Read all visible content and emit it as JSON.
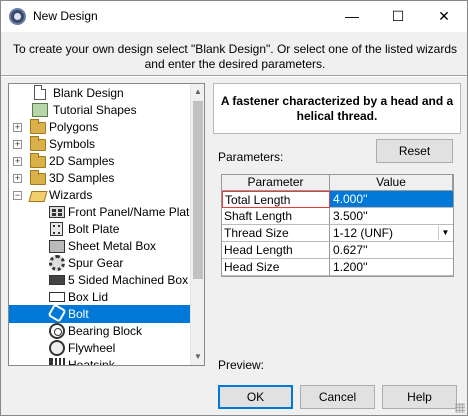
{
  "window": {
    "title": "New Design",
    "minimize_glyph": "—",
    "maximize_glyph": "☐",
    "close_glyph": "✕"
  },
  "instructions": "To create your own design select \"Blank Design\". Or select one of the listed wizards and enter the desired parameters.",
  "tree": {
    "items": [
      {
        "label": "Blank Design",
        "icon": "blank-doc-icon"
      },
      {
        "label": "Tutorial Shapes",
        "icon": "shapes-icon"
      },
      {
        "label": "Polygons",
        "icon": "folder-icon",
        "expander": "+"
      },
      {
        "label": "Symbols",
        "icon": "folder-icon",
        "expander": "+"
      },
      {
        "label": "2D Samples",
        "icon": "folder-icon",
        "expander": "+"
      },
      {
        "label": "3D Samples",
        "icon": "folder-icon",
        "expander": "+"
      },
      {
        "label": "Wizards",
        "icon": "folder-open-icon",
        "expander": "−"
      },
      {
        "label": "Front Panel/Name Plate/",
        "icon": "panel-icon"
      },
      {
        "label": "Bolt Plate",
        "icon": "bolt-plate-icon"
      },
      {
        "label": "Sheet Metal Box",
        "icon": "sheet-metal-box-icon"
      },
      {
        "label": "Spur Gear",
        "icon": "gear-icon"
      },
      {
        "label": "5 Sided Machined Box",
        "icon": "machined-box-icon"
      },
      {
        "label": "Box Lid",
        "icon": "box-lid-icon"
      },
      {
        "label": "Bolt",
        "icon": "bolt-icon",
        "selected": true
      },
      {
        "label": "Bearing Block",
        "icon": "bearing-icon"
      },
      {
        "label": "Flywheel",
        "icon": "flywheel-icon"
      },
      {
        "label": "Heatsink",
        "icon": "heatsink-icon"
      }
    ],
    "scroll_up_glyph": "▲",
    "scroll_down_glyph": "▼"
  },
  "description": "A fastener characterized by a head and a helical thread.",
  "parameters": {
    "label": "Parameters:",
    "reset_label": "Reset",
    "columns": [
      "Parameter",
      "Value"
    ],
    "rows": [
      {
        "name": "Total Length",
        "value": "4.000''"
      },
      {
        "name": "Shaft Length",
        "value": "3.500''"
      },
      {
        "name": "Thread Size",
        "value": "1-12 (UNF)"
      },
      {
        "name": "Head Length",
        "value": "0.627''"
      },
      {
        "name": "Head Size",
        "value": "1.200''"
      }
    ],
    "combo_arrow": "▼"
  },
  "preview_label": "Preview:",
  "buttons": {
    "ok": "OK",
    "cancel": "Cancel",
    "help": "Help"
  }
}
